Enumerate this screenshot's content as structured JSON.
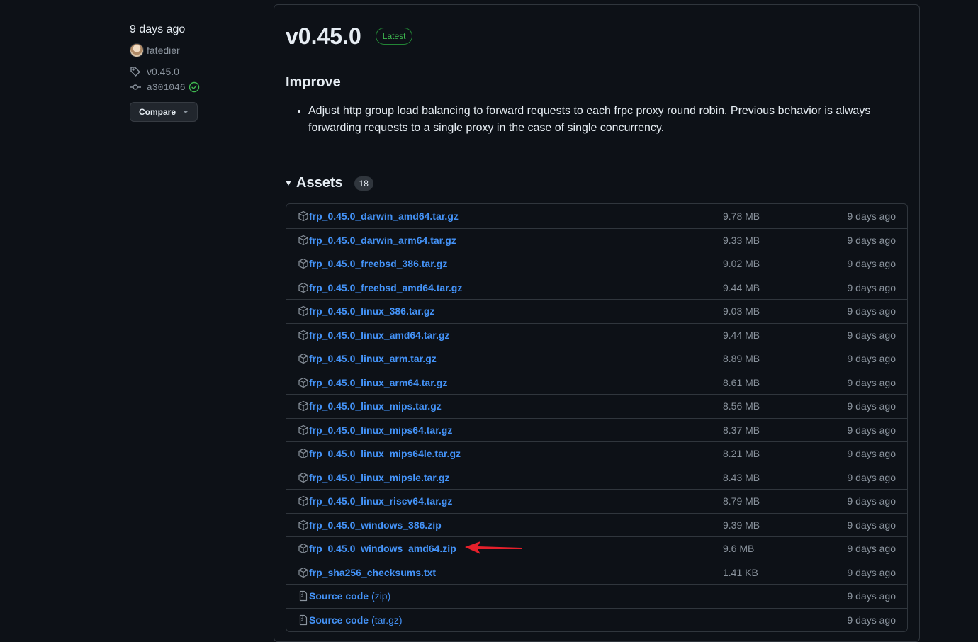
{
  "sidebar": {
    "date": "9 days ago",
    "author": "fatedier",
    "tag": "v0.45.0",
    "commit": "a301046",
    "compare_label": "Compare"
  },
  "release": {
    "title": "v0.45.0",
    "badge": "Latest",
    "section_heading": "Improve",
    "notes": [
      "Adjust http group load balancing to forward requests to each frpc proxy round robin. Previous behavior is always forwarding requests to a single proxy in the case of single concurrency."
    ]
  },
  "assets": {
    "title": "Assets",
    "count": "18",
    "rows": [
      {
        "name": "frp_0.45.0_darwin_amd64.tar.gz",
        "size": "9.78 MB",
        "date": "9 days ago",
        "icon": "package-icon"
      },
      {
        "name": "frp_0.45.0_darwin_arm64.tar.gz",
        "size": "9.33 MB",
        "date": "9 days ago",
        "icon": "package-icon"
      },
      {
        "name": "frp_0.45.0_freebsd_386.tar.gz",
        "size": "9.02 MB",
        "date": "9 days ago",
        "icon": "package-icon"
      },
      {
        "name": "frp_0.45.0_freebsd_amd64.tar.gz",
        "size": "9.44 MB",
        "date": "9 days ago",
        "icon": "package-icon"
      },
      {
        "name": "frp_0.45.0_linux_386.tar.gz",
        "size": "9.03 MB",
        "date": "9 days ago",
        "icon": "package-icon"
      },
      {
        "name": "frp_0.45.0_linux_amd64.tar.gz",
        "size": "9.44 MB",
        "date": "9 days ago",
        "icon": "package-icon"
      },
      {
        "name": "frp_0.45.0_linux_arm.tar.gz",
        "size": "8.89 MB",
        "date": "9 days ago",
        "icon": "package-icon"
      },
      {
        "name": "frp_0.45.0_linux_arm64.tar.gz",
        "size": "8.61 MB",
        "date": "9 days ago",
        "icon": "package-icon"
      },
      {
        "name": "frp_0.45.0_linux_mips.tar.gz",
        "size": "8.56 MB",
        "date": "9 days ago",
        "icon": "package-icon"
      },
      {
        "name": "frp_0.45.0_linux_mips64.tar.gz",
        "size": "8.37 MB",
        "date": "9 days ago",
        "icon": "package-icon"
      },
      {
        "name": "frp_0.45.0_linux_mips64le.tar.gz",
        "size": "8.21 MB",
        "date": "9 days ago",
        "icon": "package-icon"
      },
      {
        "name": "frp_0.45.0_linux_mipsle.tar.gz",
        "size": "8.43 MB",
        "date": "9 days ago",
        "icon": "package-icon"
      },
      {
        "name": "frp_0.45.0_linux_riscv64.tar.gz",
        "size": "8.79 MB",
        "date": "9 days ago",
        "icon": "package-icon"
      },
      {
        "name": "frp_0.45.0_windows_386.zip",
        "size": "9.39 MB",
        "date": "9 days ago",
        "icon": "package-icon"
      },
      {
        "name": "frp_0.45.0_windows_amd64.zip",
        "size": "9.6 MB",
        "date": "9 days ago",
        "icon": "package-icon",
        "annotated": true
      },
      {
        "name": "frp_sha256_checksums.txt",
        "size": "1.41 KB",
        "date": "9 days ago",
        "icon": "package-icon"
      },
      {
        "name": "Source code",
        "suffix": "(zip)",
        "size": "",
        "date": "9 days ago",
        "icon": "file-zip-icon"
      },
      {
        "name": "Source code",
        "suffix": "(tar.gz)",
        "size": "",
        "date": "9 days ago",
        "icon": "file-zip-icon"
      }
    ]
  },
  "colors": {
    "background": "#0d1117",
    "link": "#4493f8",
    "muted": "#8b949e",
    "border": "#30363d",
    "latest_green": "#3fb950",
    "annotation_arrow": "#e5202b"
  }
}
